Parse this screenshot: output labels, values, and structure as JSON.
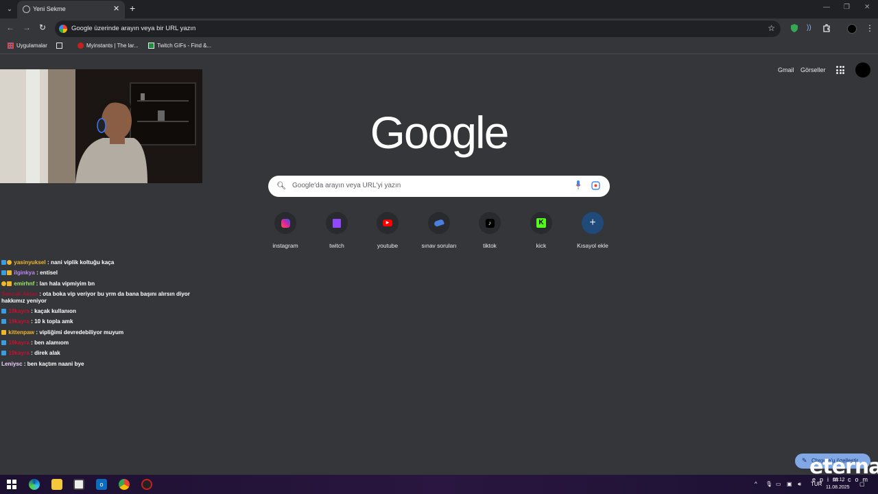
{
  "tab": {
    "title": "Yeni Sekme"
  },
  "omnibox": {
    "text": "Google üzerinde arayın veya bir URL yazın"
  },
  "bookmarks": [
    {
      "label": "Uygulamalar"
    },
    {
      "label": "Myinstants | The lar..."
    },
    {
      "label": "Twitch GIFs - Find &..."
    }
  ],
  "header": {
    "gmail": "Gmail",
    "images": "Görseller"
  },
  "logo": "Google",
  "search": {
    "placeholder": "Google'da arayın veya URL'yi yazın"
  },
  "shortcuts": [
    {
      "label": "instagram"
    },
    {
      "label": "twitch"
    },
    {
      "label": "youtube"
    },
    {
      "label": "sınav soruları"
    },
    {
      "label": "tiktok"
    },
    {
      "label": "kick"
    },
    {
      "label": "Kısayol ekle"
    }
  ],
  "chat": [
    {
      "user": "yasinyuksel",
      "text": ": nani viplik koltuğu kaça"
    },
    {
      "user": "ilginkya",
      "text": ": entisel"
    },
    {
      "user": "emirhnf",
      "text": ": lan hala vipmiyim bn"
    },
    {
      "user": "Sancak Aktas",
      "text": ": ota boka vip veriyor bu yrm da bana başını alırsın diyor hakkımız yeniyor"
    },
    {
      "user": "19kayra",
      "text": ": kaçak kullanıon"
    },
    {
      "user": "19kayra",
      "text": ": 10 k topla amk"
    },
    {
      "user": "kittenpaw",
      "text": ": vipliğimi devredebiliyor muyum"
    },
    {
      "user": "19kayra",
      "text": ": ben alamıom"
    },
    {
      "user": "19kayra",
      "text": ": direk alak"
    },
    {
      "user": "Leniysc",
      "text": ": ben kaçtım naani bye"
    }
  ],
  "customize": {
    "label": "Chrome'u özelleştir"
  },
  "taskbar": {
    "lang": "TUR",
    "time": "03:12",
    "date": "11.08.2025"
  },
  "watermark": {
    "main": "eternal",
    "sub": "epim.com"
  }
}
